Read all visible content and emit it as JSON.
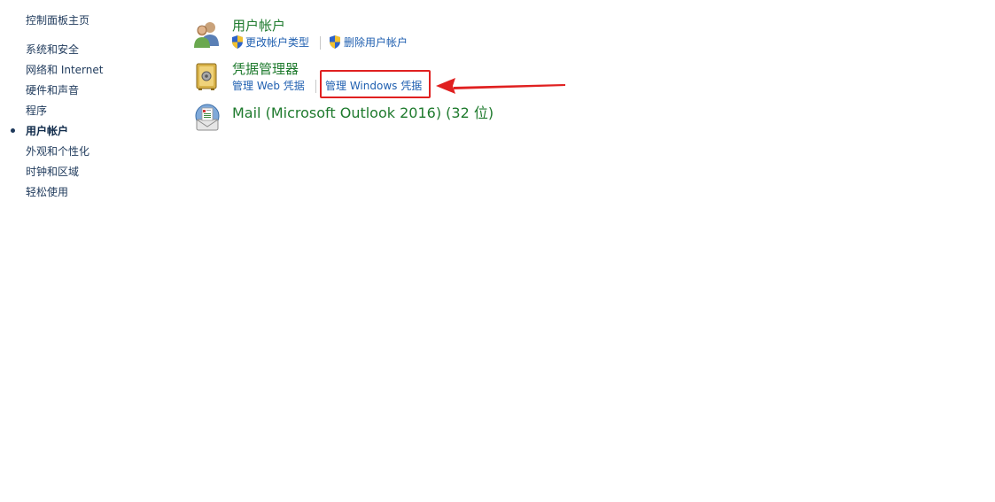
{
  "sidebar": {
    "home": "控制面板主页",
    "items": [
      {
        "label": "系统和安全"
      },
      {
        "label": "网络和 Internet"
      },
      {
        "label": "硬件和声音"
      },
      {
        "label": "程序"
      },
      {
        "label": "用户帐户",
        "current": true
      },
      {
        "label": "外观和个性化"
      },
      {
        "label": "时钟和区域"
      },
      {
        "label": "轻松使用"
      }
    ]
  },
  "main": {
    "categories": [
      {
        "title": "用户帐户",
        "icon": "users-icon",
        "links": [
          {
            "label": "更改帐户类型",
            "icon": "uac-shield-icon"
          },
          {
            "label": "删除用户帐户",
            "icon": "uac-shield-icon"
          }
        ]
      },
      {
        "title": "凭据管理器",
        "icon": "credential-vault-icon",
        "links": [
          {
            "label": "管理 Web 凭据"
          },
          {
            "label": "管理 Windows 凭据",
            "highlighted": true
          }
        ]
      },
      {
        "title": "Mail (Microsoft Outlook 2016) (32 位)",
        "icon": "mail-icon",
        "links": []
      }
    ]
  },
  "annotation": {
    "color": "#e02020",
    "target": "管理 Windows 凭据"
  }
}
